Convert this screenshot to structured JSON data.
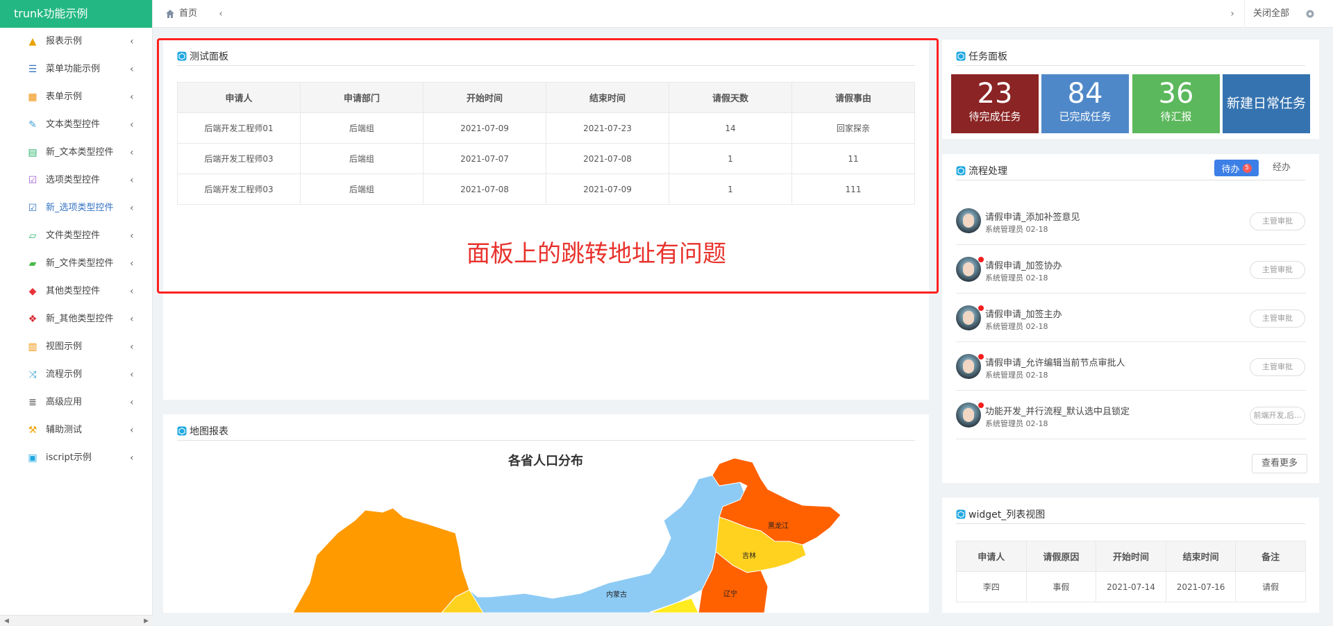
{
  "app": {
    "brand": "trunk功能示例"
  },
  "sidebar": {
    "items": [
      {
        "label": "报表示例",
        "icon": "chart-area-icon",
        "color": "#e8a200"
      },
      {
        "label": "菜单功能示例",
        "icon": "list-icon",
        "color": "#3573c2"
      },
      {
        "label": "表单示例",
        "icon": "table-icon",
        "color": "#f08c00"
      },
      {
        "label": "文本类型控件",
        "icon": "edit-icon",
        "color": "#3fa0d8"
      },
      {
        "label": "新_文本类型控件",
        "icon": "file-text-icon",
        "color": "#24b36b"
      },
      {
        "label": "选项类型控件",
        "icon": "checkbox-icon",
        "color": "#a35bd6"
      },
      {
        "label": "新_选项类型控件",
        "icon": "checkbox-checked-icon",
        "color": "#3573c2",
        "active": true
      },
      {
        "label": "文件类型控件",
        "icon": "folder-open-icon",
        "color": "#24b36b"
      },
      {
        "label": "新_文件类型控件",
        "icon": "folder-open-filled-icon",
        "color": "#4cb84c"
      },
      {
        "label": "其他类型控件",
        "icon": "cube-icon",
        "color": "#e8323c"
      },
      {
        "label": "新_其他类型控件",
        "icon": "cubes-icon",
        "color": "#d8262f"
      },
      {
        "label": "视图示例",
        "icon": "columns-icon",
        "color": "#f08c00"
      },
      {
        "label": "流程示例",
        "icon": "random-icon",
        "color": "#3fa0d8"
      },
      {
        "label": "高级应用",
        "icon": "server-icon",
        "color": "#555555"
      },
      {
        "label": "辅助测试",
        "icon": "wrench-icon",
        "color": "#f0a000"
      },
      {
        "label": "iscript示例",
        "icon": "cube-box-icon",
        "color": "#1ea7e0"
      }
    ]
  },
  "topbar": {
    "home_tab": "首页",
    "close_all": "关闭全部"
  },
  "test_panel": {
    "title": "测试面板",
    "columns": [
      "申请人",
      "申请部门",
      "开始时间",
      "结束时间",
      "请假天数",
      "请假事由"
    ],
    "rows": [
      [
        "后端开发工程师01",
        "后端组",
        "2021-07-09",
        "2021-07-23",
        "14",
        "回家探亲"
      ],
      [
        "后端开发工程师03",
        "后端组",
        "2021-07-07",
        "2021-07-08",
        "1",
        "11"
      ],
      [
        "后端开发工程师03",
        "后端组",
        "2021-07-08",
        "2021-07-09",
        "1",
        "111"
      ]
    ],
    "annotation": "面板上的跳转地址有问题"
  },
  "map_panel": {
    "title": "地图报表",
    "chart_title": "各省人口分布",
    "labels": [
      "黑龙江",
      "吉林",
      "辽宁",
      "内蒙古"
    ]
  },
  "task_panel": {
    "title": "任务面板",
    "tiles": [
      {
        "num": "23",
        "label": "待完成任务",
        "color": "#8b2424"
      },
      {
        "num": "84",
        "label": "已完成任务",
        "color": "#4f88c8"
      },
      {
        "num": "36",
        "label": "待汇报",
        "color": "#5cb85c"
      }
    ],
    "new_task": {
      "label": "新建日常任务",
      "color": "#3573b0"
    }
  },
  "flow_panel": {
    "title": "流程处理",
    "tab_todo": "待办",
    "tab_todo_badge": "5",
    "tab_done": "经办",
    "items": [
      {
        "title": "请假申请_添加补签意见",
        "meta": "系统管理员 02-18",
        "action": "主管审批",
        "unread": false
      },
      {
        "title": "请假申请_加签协办",
        "meta": "系统管理员 02-18",
        "action": "主管审批",
        "unread": true
      },
      {
        "title": "请假申请_加签主办",
        "meta": "系统管理员 02-18",
        "action": "主管审批",
        "unread": true
      },
      {
        "title": "请假申请_允许编辑当前节点审批人",
        "meta": "系统管理员 02-18",
        "action": "主管审批",
        "unread": true
      },
      {
        "title": "功能开发_并行流程_默认选中且锁定",
        "meta": "系统管理员 02-18",
        "action": "前端开发,后...",
        "unread": true
      }
    ],
    "view_more": "查看更多"
  },
  "widget_panel": {
    "title": "widget_列表视图",
    "columns": [
      "申请人",
      "请假原因",
      "开始时间",
      "结束时间",
      "备注"
    ],
    "rows": [
      [
        "李四",
        "事假",
        "2021-07-14",
        "2021-07-16",
        "请假"
      ]
    ]
  }
}
